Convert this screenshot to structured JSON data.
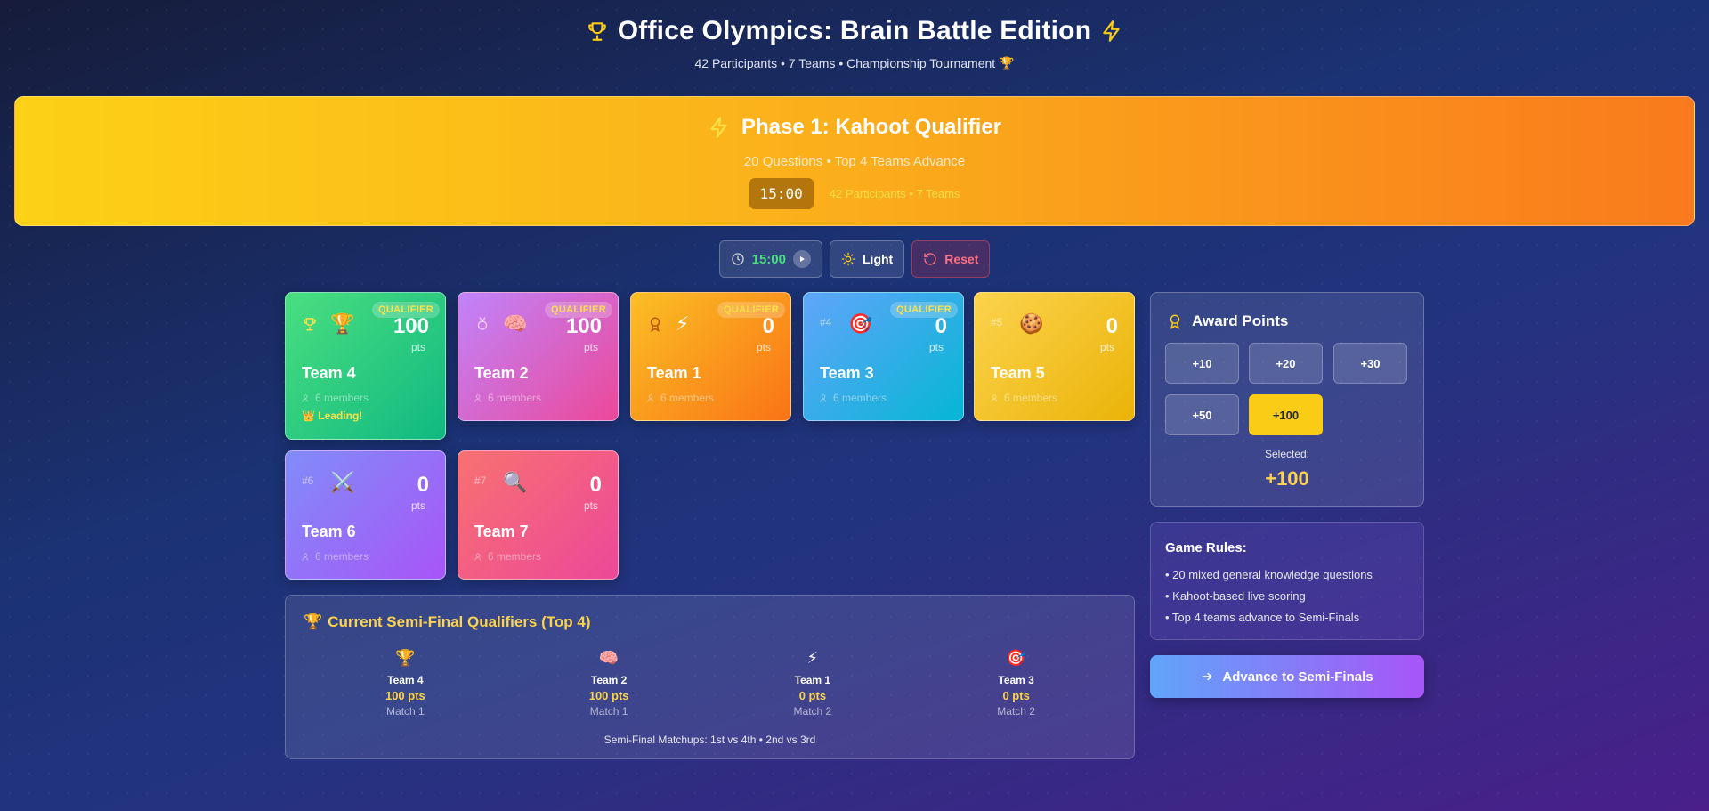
{
  "header": {
    "title": "Office Olympics: Brain Battle Edition",
    "subtitle": "42 Participants • 7 Teams • Championship Tournament 🏆"
  },
  "phase": {
    "title": "Phase 1: Kahoot Qualifier",
    "subtitle": "20 Questions • Top 4 Teams Advance",
    "timer": "15:00",
    "participants": "42 Participants • 7 Teams"
  },
  "controls": {
    "timer": "15:00",
    "theme_label": "Light",
    "reset_label": "Reset"
  },
  "teams": [
    {
      "name": "Team 4",
      "score": "100",
      "pts": "pts",
      "members": "6 members",
      "emoji": "🏆",
      "badge": "QUALIFIER",
      "rank": "",
      "leading": "👑 Leading!"
    },
    {
      "name": "Team 2",
      "score": "100",
      "pts": "pts",
      "members": "6 members",
      "emoji": "🧠",
      "badge": "QUALIFIER",
      "rank": ""
    },
    {
      "name": "Team 1",
      "score": "0",
      "pts": "pts",
      "members": "6 members",
      "emoji": "⚡",
      "badge": "QUALIFIER",
      "rank": ""
    },
    {
      "name": "Team 3",
      "score": "0",
      "pts": "pts",
      "members": "6 members",
      "emoji": "🎯",
      "badge": "QUALIFIER",
      "rank": "#4"
    },
    {
      "name": "Team 5",
      "score": "0",
      "pts": "pts",
      "members": "6 members",
      "emoji": "🍪",
      "badge": "",
      "rank": "#5"
    },
    {
      "name": "Team 6",
      "score": "0",
      "pts": "pts",
      "members": "6 members",
      "emoji": "⚔️",
      "badge": "",
      "rank": "#6"
    },
    {
      "name": "Team 7",
      "score": "0",
      "pts": "pts",
      "members": "6 members",
      "emoji": "🔍",
      "badge": "",
      "rank": "#7"
    }
  ],
  "semis": {
    "title": "Current Semi-Final Qualifiers (Top 4)",
    "qualifiers": [
      {
        "emoji": "🏆",
        "name": "Team 4",
        "points": "100 pts",
        "match": "Match 1"
      },
      {
        "emoji": "🧠",
        "name": "Team 2",
        "points": "100 pts",
        "match": "Match 1"
      },
      {
        "emoji": "⚡",
        "name": "Team 1",
        "points": "0 pts",
        "match": "Match 2"
      },
      {
        "emoji": "🎯",
        "name": "Team 3",
        "points": "0 pts",
        "match": "Match 2"
      }
    ],
    "footer": "Semi-Final Matchups: 1st vs 4th • 2nd vs 3rd"
  },
  "award": {
    "title": "Award Points",
    "options": [
      "+10",
      "+20",
      "+30",
      "+50",
      "+100"
    ],
    "selected_label": "Selected:",
    "selected_value": "+100"
  },
  "rules": {
    "title": "Game Rules:",
    "items": [
      "• 20 mixed general knowledge questions",
      "• Kahoot-based live scoring",
      "• Top 4 teams advance to Semi-Finals"
    ]
  },
  "advance_label": "Advance to Semi-Finals",
  "colors": {
    "accent_yellow": "#fcd34d",
    "timer_green": "#4ade80",
    "reset_red": "#fb7185"
  }
}
